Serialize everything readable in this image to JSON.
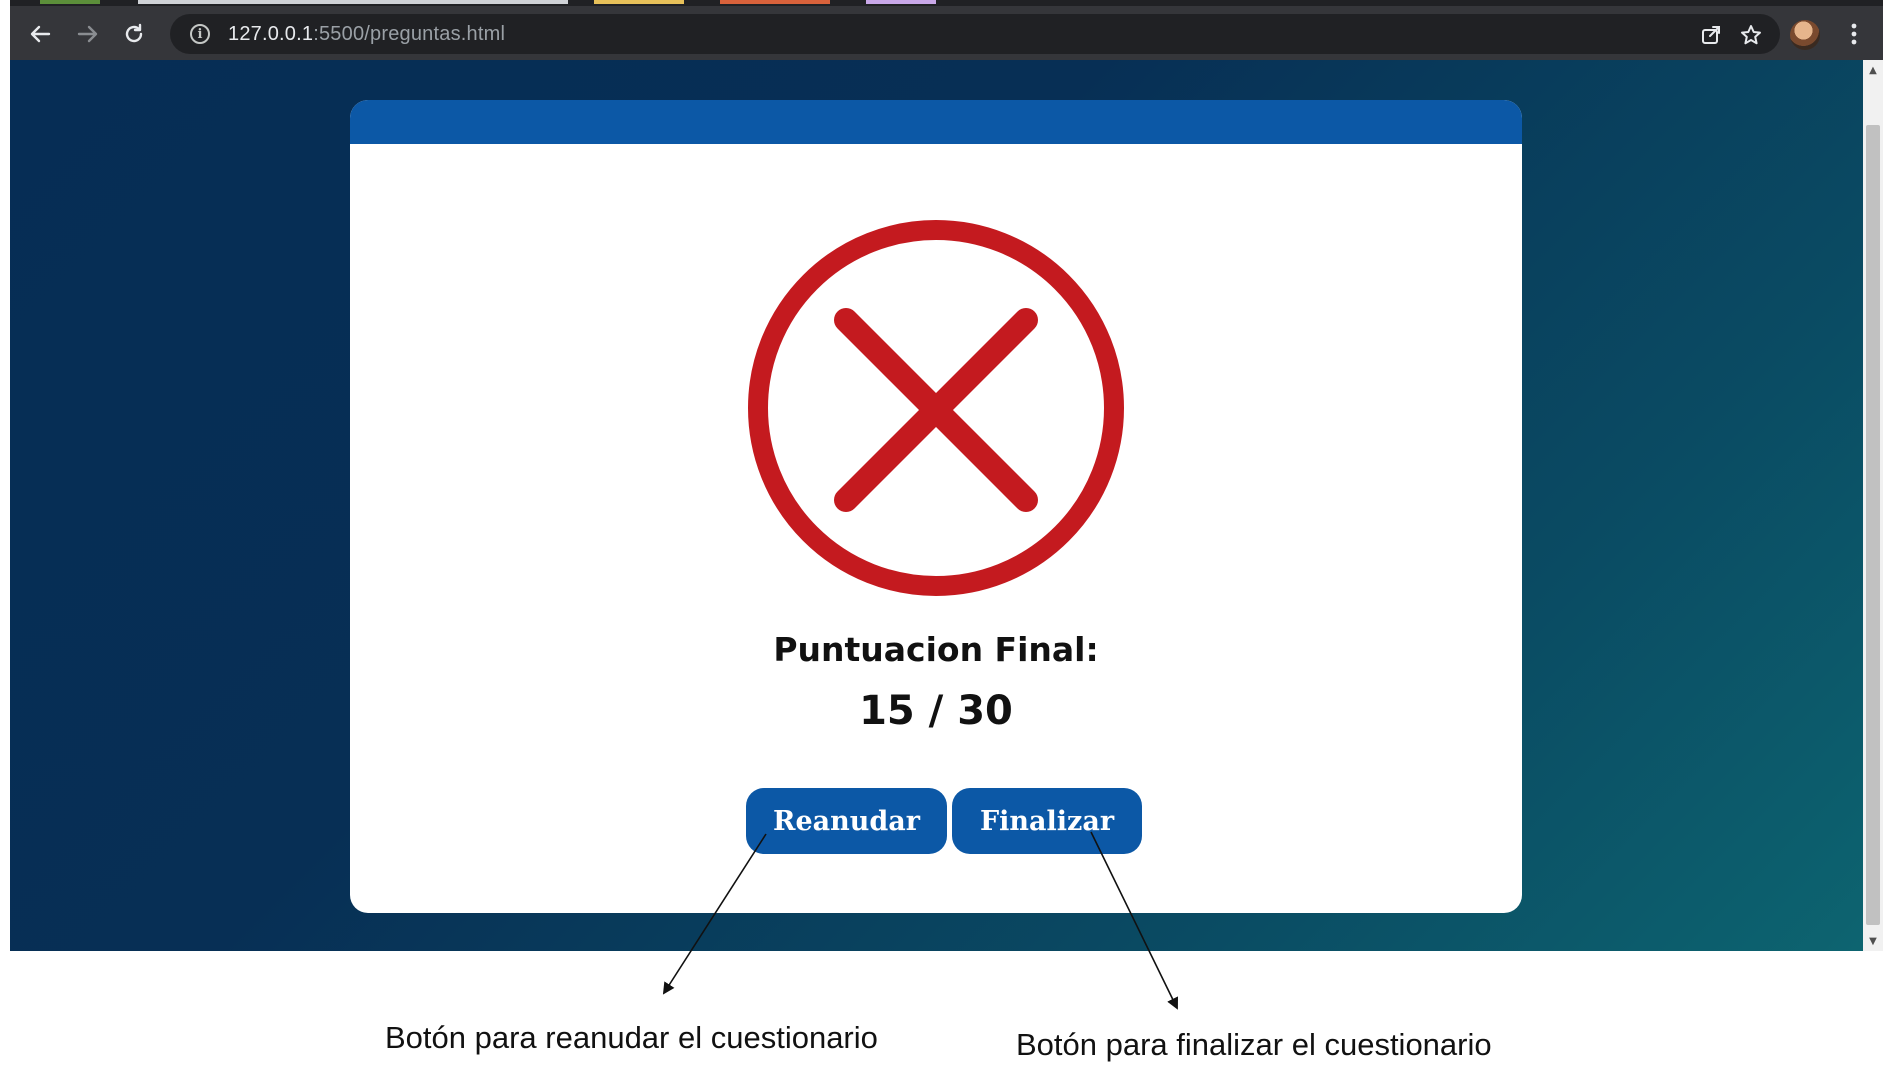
{
  "browser": {
    "url_host": "127.0.0.1",
    "url_rest": ":5500/preguntas.html",
    "icons": {
      "back": "back-arrow-icon",
      "forward": "forward-arrow-icon",
      "reload": "reload-icon",
      "site_info": "info-icon",
      "share": "share-icon",
      "bookmark": "star-icon",
      "profile": "avatar",
      "menu": "more-vert-icon"
    }
  },
  "result": {
    "status_icon": "fail-x-circle-icon",
    "title": "Puntuacion Final:",
    "score": "15 / 30",
    "buttons": {
      "resume": "Reanudar",
      "finish": "Finalizar"
    }
  },
  "annotations": {
    "resume_caption": "Botón para reanudar el cuestionario",
    "finish_caption": "Botón para finalizar el cuestionario"
  },
  "colors": {
    "primary_blue": "#0c58a6",
    "error_red": "#c41a1f",
    "background_dark": "#062d55",
    "background_teal": "#0d6470"
  }
}
